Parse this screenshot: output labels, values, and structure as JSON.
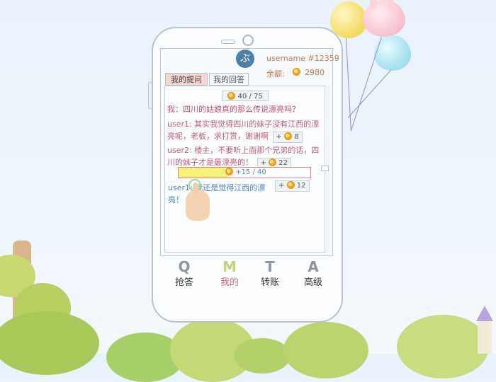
{
  "profile": {
    "avatar_glyph": "ぶ",
    "username": "username #12359",
    "balance_label": "余额:",
    "balance_value": "2980"
  },
  "tabs": [
    {
      "label": "我的提问",
      "active": true
    },
    {
      "label": "我的回答",
      "active": false
    }
  ],
  "question": {
    "prize": "40 / 75",
    "text": "我：四川的姑娘真的那么传说漂亮吗？"
  },
  "replies": [
    {
      "text": "user1: 其实我觉得四川的妹子没有江西的漂亮呢，老板，求打赏，谢谢啊",
      "reward_label": "+",
      "reward_value": "8"
    },
    {
      "text": "user2: 楼主，不要听上面那个兄弟的话，四川的妹子才是最漂亮的！",
      "reward_label": "+",
      "reward_value": "22"
    },
    {
      "text": "user1: 我还是觉得江西的漂亮！",
      "reward_label": "+",
      "reward_value": "12"
    }
  ],
  "bid": {
    "text": "+15 / 40",
    "fill_fraction": 0.38
  },
  "nav": [
    {
      "letter": "Q",
      "label": "抢答",
      "active": false
    },
    {
      "letter": "M",
      "label": "我的",
      "active": true
    },
    {
      "letter": "T",
      "label": "转账",
      "active": false
    },
    {
      "letter": "A",
      "label": "高级",
      "active": false
    }
  ],
  "colors": {
    "accent_pink": "#c05a78",
    "accent_blue": "#4f86b8",
    "coin_gold": "#f1a21e",
    "bid_fill": "#f6f27a"
  },
  "icons": [
    "avatar-icon",
    "coin-icon",
    "touch-hand-icon",
    "balloon-icon"
  ]
}
